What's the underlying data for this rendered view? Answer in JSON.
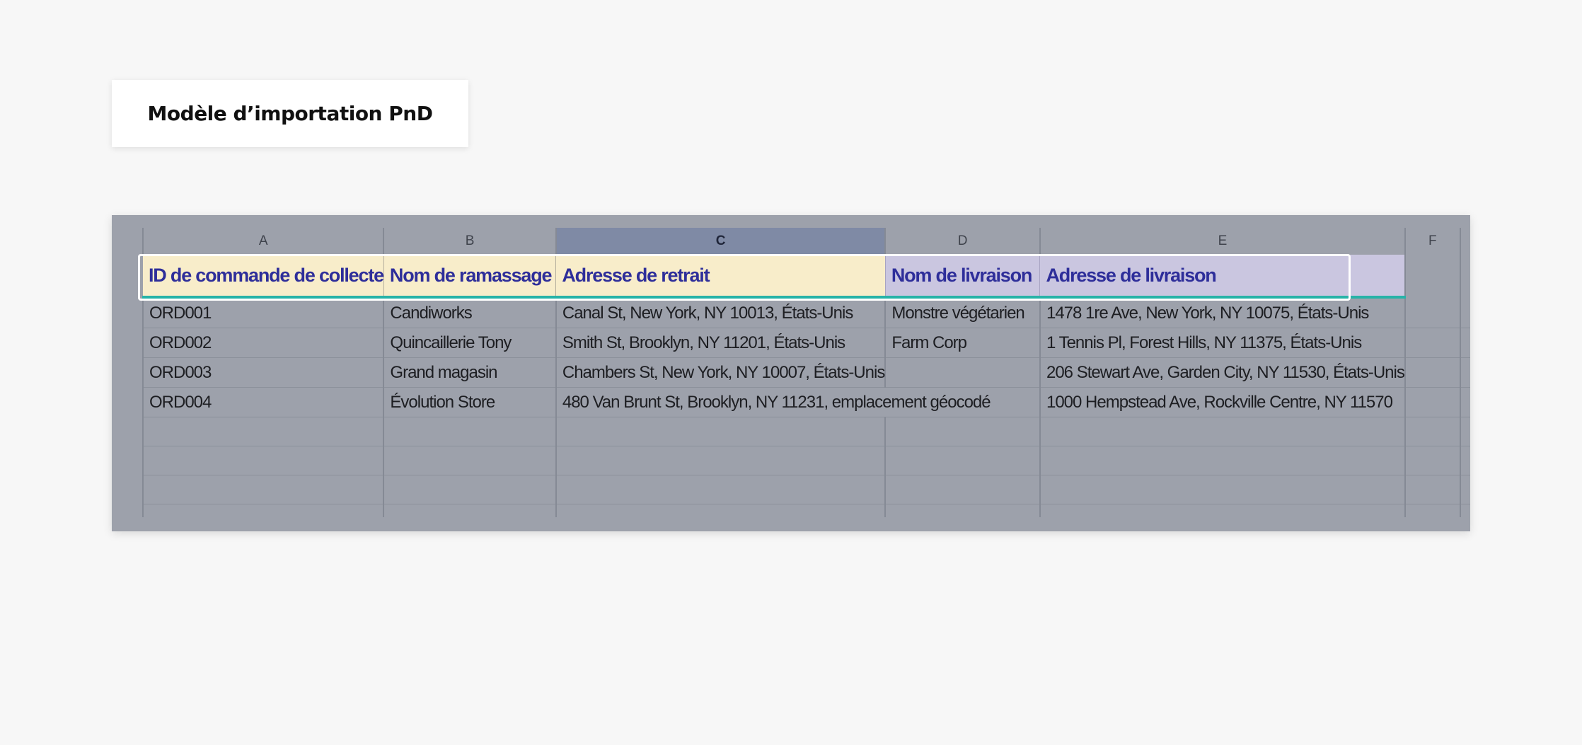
{
  "title": "Modèle d’importation PnD",
  "columns": [
    {
      "letter": "A",
      "header": "ID de commande de collecte"
    },
    {
      "letter": "B",
      "header": "Nom de ramassage"
    },
    {
      "letter": "C",
      "header": "Adresse de retrait"
    },
    {
      "letter": "D",
      "header": "Nom de livraison"
    },
    {
      "letter": "E",
      "header": "Adresse de livraison"
    },
    {
      "letter": "F",
      "header": ""
    }
  ],
  "selected_column": "C",
  "rows": [
    [
      "ORD001",
      "Candiworks",
      "Canal St, New York, NY 10013, États-Unis",
      "Monstre végétarien",
      "1478 1re Ave, New York, NY 10075, États-Unis",
      ""
    ],
    [
      "ORD002",
      "Quincaillerie Tony",
      "Smith St, Brooklyn, NY 11201, États-Unis",
      "Farm Corp",
      "1 Tennis Pl, Forest Hills, NY 11375, États-Unis",
      ""
    ],
    [
      "ORD003",
      "Grand magasin",
      "Chambers St, New York, NY 10007, États-Unis",
      "",
      "206 Stewart Ave, Garden City, NY 11530, États-Unis",
      ""
    ],
    [
      "ORD004",
      "Évolution Store",
      "480 Van Brunt St, Brooklyn, NY 11231, emplacement géocodé",
      "",
      "1000 Hempstead Ave, Rockville Centre, NY 11570",
      ""
    ]
  ],
  "colors": {
    "header_text": "#2e2e9a",
    "pickup_header_bg": "#f8edca",
    "delivery_header_bg": "#cac6e0",
    "header_underline": "#27b3a8",
    "sheet_overlay": "#9da1ab",
    "selected_column_bg": "#7f8aa5"
  }
}
